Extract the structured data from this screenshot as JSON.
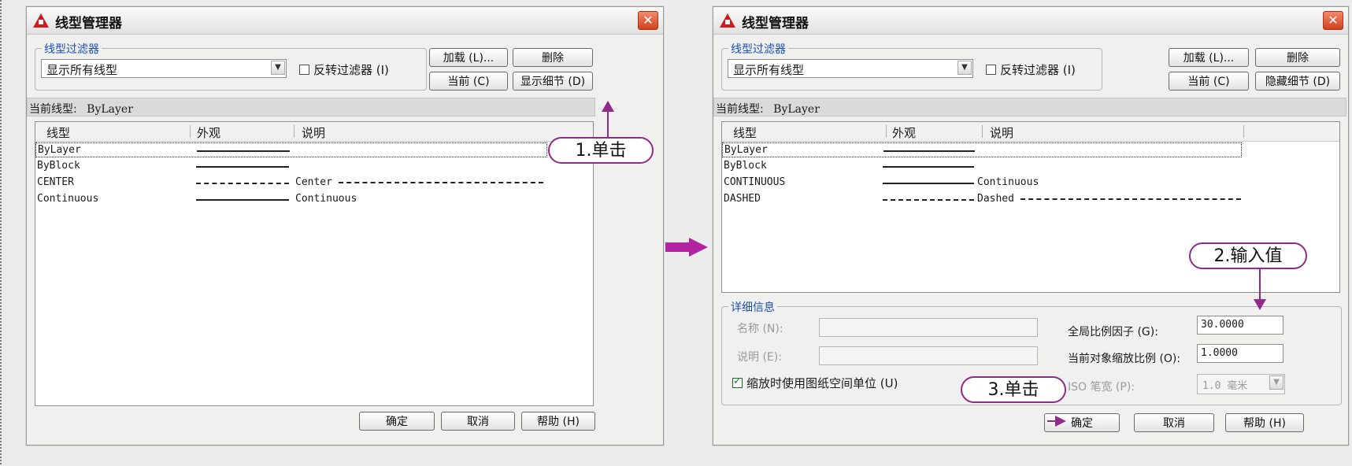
{
  "dialog_title": "线型管理器",
  "close_glyph": "✕",
  "filter_group_label": "线型过滤器",
  "filter_select_value": "显示所有线型",
  "invert_filter_label": "反转过滤器 (I)",
  "buttons": {
    "load": "加载 (L)...",
    "delete": "删除",
    "current": "当前 (C)",
    "show_details": "显示细节 (D)",
    "hide_details": "隐藏细节 (D)",
    "ok": "确定",
    "cancel": "取消",
    "help": "帮助 (H)"
  },
  "current_linetype_label": "当前线型:",
  "current_linetype_value": "ByLayer",
  "list_headers": {
    "linetype": "线型",
    "appearance": "外观",
    "description": "说明"
  },
  "list1": [
    {
      "name": "ByLayer",
      "pattern": "solid",
      "desc": ""
    },
    {
      "name": "ByBlock",
      "pattern": "solid",
      "desc": ""
    },
    {
      "name": "CENTER",
      "pattern": "dashdot",
      "desc": "Center"
    },
    {
      "name": "Continuous",
      "pattern": "solid",
      "desc": "Continuous"
    }
  ],
  "list2": [
    {
      "name": "ByLayer",
      "pattern": "solid",
      "desc": ""
    },
    {
      "name": "ByBlock",
      "pattern": "solid",
      "desc": ""
    },
    {
      "name": "CONTINUOUS",
      "pattern": "solid",
      "desc": "Continuous"
    },
    {
      "name": "DASHED",
      "pattern": "dashed",
      "desc": "Dashed"
    }
  ],
  "details": {
    "group_label": "详细信息",
    "name_label": "名称 (N):",
    "desc_label": "说明 (E):",
    "paper_space_checkbox": "缩放时使用图纸空间单位 (U)",
    "global_scale_label": "全局比例因子 (G):",
    "global_scale_value": "30.0000",
    "current_scale_label": "当前对象缩放比例 (O):",
    "current_scale_value": "1.0000",
    "iso_pen_label": "ISO 笔宽 (P):",
    "iso_pen_value": "1.0 毫米"
  },
  "callouts": {
    "step1": "1.单击",
    "step2": "2.输入值",
    "step3": "3.单击"
  },
  "colors": {
    "accent": "#8f2a8a",
    "arrow": "#b3239f",
    "group_label": "#1d4fb0"
  }
}
